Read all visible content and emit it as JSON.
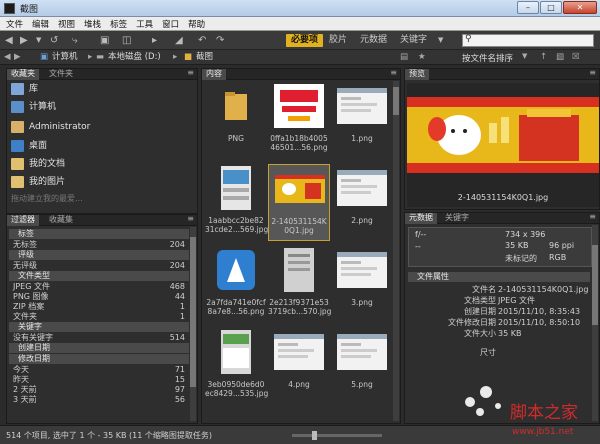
{
  "window": {
    "title": "截图"
  },
  "menu": [
    "文件",
    "编辑",
    "视图",
    "堆栈",
    "标签",
    "工具",
    "窗口",
    "帮助"
  ],
  "toolbar": {
    "workspaces": [
      "必要项",
      "胶片",
      "元数据",
      "关键字"
    ],
    "active_workspace": "必要项",
    "search_placeholder": ""
  },
  "breadcrumb": [
    "计算机",
    "本地磁盘 (D:)",
    "截图"
  ],
  "sort": {
    "label": "按文件名排序"
  },
  "favorites_panel": {
    "tabs": [
      "收藏夹",
      "文件夹"
    ],
    "items": [
      "库",
      "计算机",
      "Administrator",
      "桌面",
      "我的文档",
      "我的图片",
      "拖动建立我的最爱..."
    ]
  },
  "filter_panel": {
    "tabs": [
      "过滤器",
      "收藏集"
    ],
    "sections": [
      {
        "header": "标签",
        "rows": [
          {
            "label": "无标签",
            "count": "204"
          }
        ]
      },
      {
        "header": "评级",
        "rows": [
          {
            "label": "无评级",
            "count": "204"
          }
        ]
      },
      {
        "header": "文件类型",
        "rows": [
          {
            "label": "JPEG 文件",
            "count": "468"
          },
          {
            "label": "PNG 图像",
            "count": "44"
          },
          {
            "label": "ZIP 档案",
            "count": "1"
          },
          {
            "label": "文件夹",
            "count": "1"
          }
        ]
      },
      {
        "header": "关键字",
        "rows": [
          {
            "label": "没有关键字",
            "count": "514"
          }
        ]
      },
      {
        "header": "创建日期",
        "rows": []
      },
      {
        "header": "修改日期",
        "rows": [
          {
            "label": "今天",
            "count": "71"
          },
          {
            "label": "昨天",
            "count": "15"
          },
          {
            "label": "2 天前",
            "count": "97"
          },
          {
            "label": "3 天前",
            "count": "56"
          }
        ]
      }
    ]
  },
  "content_panel": {
    "tab": "内容",
    "items": [
      {
        "caption": "PNG",
        "kind": "folder"
      },
      {
        "caption": "0ffa1b18b4005\n46501...56.png",
        "kind": "ad"
      },
      {
        "caption": "1.png",
        "kind": "screen"
      },
      {
        "caption": "1aabbcc2be82\n31cde2...569.jpg",
        "kind": "phone"
      },
      {
        "caption": "2-140531154K\n0Q1.jpg",
        "kind": "banner",
        "selected": true
      },
      {
        "caption": "2.png",
        "kind": "screen"
      },
      {
        "caption": "2a7fda741e0fcf\n8a7e8...56.png",
        "kind": "app"
      },
      {
        "caption": "2e213f9371e53\n3719cb...570.jpg",
        "kind": "doc"
      },
      {
        "caption": "3.png",
        "kind": "screen"
      },
      {
        "caption": "3eb0950de6d0\nec8429...535.jpg",
        "kind": "phone2"
      },
      {
        "caption": "4.png",
        "kind": "screen"
      },
      {
        "caption": "5.png",
        "kind": "screen"
      }
    ]
  },
  "preview_panel": {
    "tab": "预览",
    "filename": "2-140531154K0Q1.jpg"
  },
  "metadata_panel": {
    "tabs": [
      "元数据",
      "关键字"
    ],
    "summary": {
      "aperture": "f/--",
      "shutter": "--",
      "dims": "734 x 396",
      "size": "35 KB",
      "ppi": "96 ppi",
      "label": "未标记的",
      "mode": "RGB"
    },
    "section": "文件属性",
    "fields": [
      {
        "k": "文件名",
        "v": "2-140531154K0Q1.jpg"
      },
      {
        "k": "文档类型",
        "v": "JPEG 文件"
      },
      {
        "k": "创建日期",
        "v": "2015/11/10, 8:35:43"
      },
      {
        "k": "文件修改日期",
        "v": "2015/11/10, 8:50:10"
      },
      {
        "k": "文件大小",
        "v": "35 KB"
      },
      {
        "k": "尺寸",
        "v": ""
      }
    ]
  },
  "status": {
    "text": "514 个项目, 选中了 1 个 - 35 KB (11 个缩略图提取任务)"
  },
  "watermark": {
    "brand": "脚本之家",
    "url": "www.jb51.net"
  }
}
